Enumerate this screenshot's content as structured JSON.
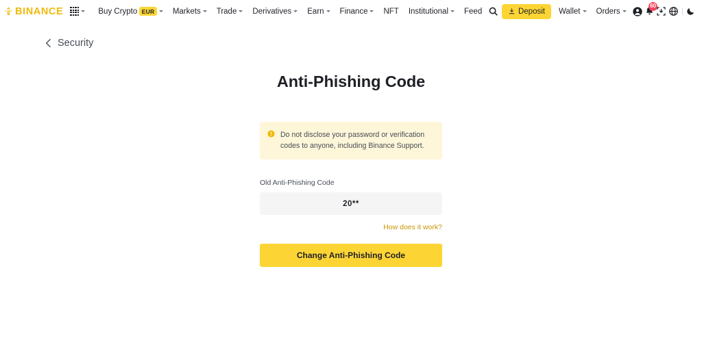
{
  "navbar": {
    "brand": "BINANCE",
    "brand_color": "#F0B90B",
    "apps_menu_icon": "grid-apps-icon",
    "items": [
      {
        "label": "Buy Crypto",
        "badge": "EUR",
        "has_caret": true
      },
      {
        "label": "Markets",
        "badge": null,
        "has_caret": true
      },
      {
        "label": "Trade",
        "badge": null,
        "has_caret": true
      },
      {
        "label": "Derivatives",
        "badge": null,
        "has_caret": true
      },
      {
        "label": "Earn",
        "badge": null,
        "has_caret": true
      },
      {
        "label": "Finance",
        "badge": null,
        "has_caret": true
      },
      {
        "label": "NFT",
        "badge": null,
        "has_caret": false
      },
      {
        "label": "Institutional",
        "badge": null,
        "has_caret": true
      },
      {
        "label": "Feed",
        "badge": null,
        "has_caret": false
      }
    ],
    "search_icon": "search-icon",
    "deposit_label": "Deposit",
    "deposit_icon": "download-icon",
    "deposit_color": "#FCD535",
    "wallet_label": "Wallet",
    "orders_label": "Orders",
    "profile_icon": "user-circle-icon",
    "notifications_icon": "bell-icon",
    "notifications_count": "60",
    "notifications_badge_color": "#F6465D",
    "download_app_icon": "download-app-icon",
    "language_icon": "globe-icon",
    "theme_icon": "moon-icon"
  },
  "breadcrumb": {
    "back_icon": "chevron-left-icon",
    "label": "Security"
  },
  "page": {
    "title": "Anti-Phishing Code"
  },
  "alert": {
    "icon": "warning-circle-icon",
    "icon_color": "#F0B90B",
    "background": "#FEF6D8",
    "text": "Do not disclose your password or verification codes to anyone, including Binance Support."
  },
  "form": {
    "old_code_label": "Old Anti-Phishing Code",
    "old_code_value": "20**",
    "help_link": "How does it work?",
    "help_link_color": "#C99400",
    "submit_label": "Change Anti-Phishing Code"
  }
}
